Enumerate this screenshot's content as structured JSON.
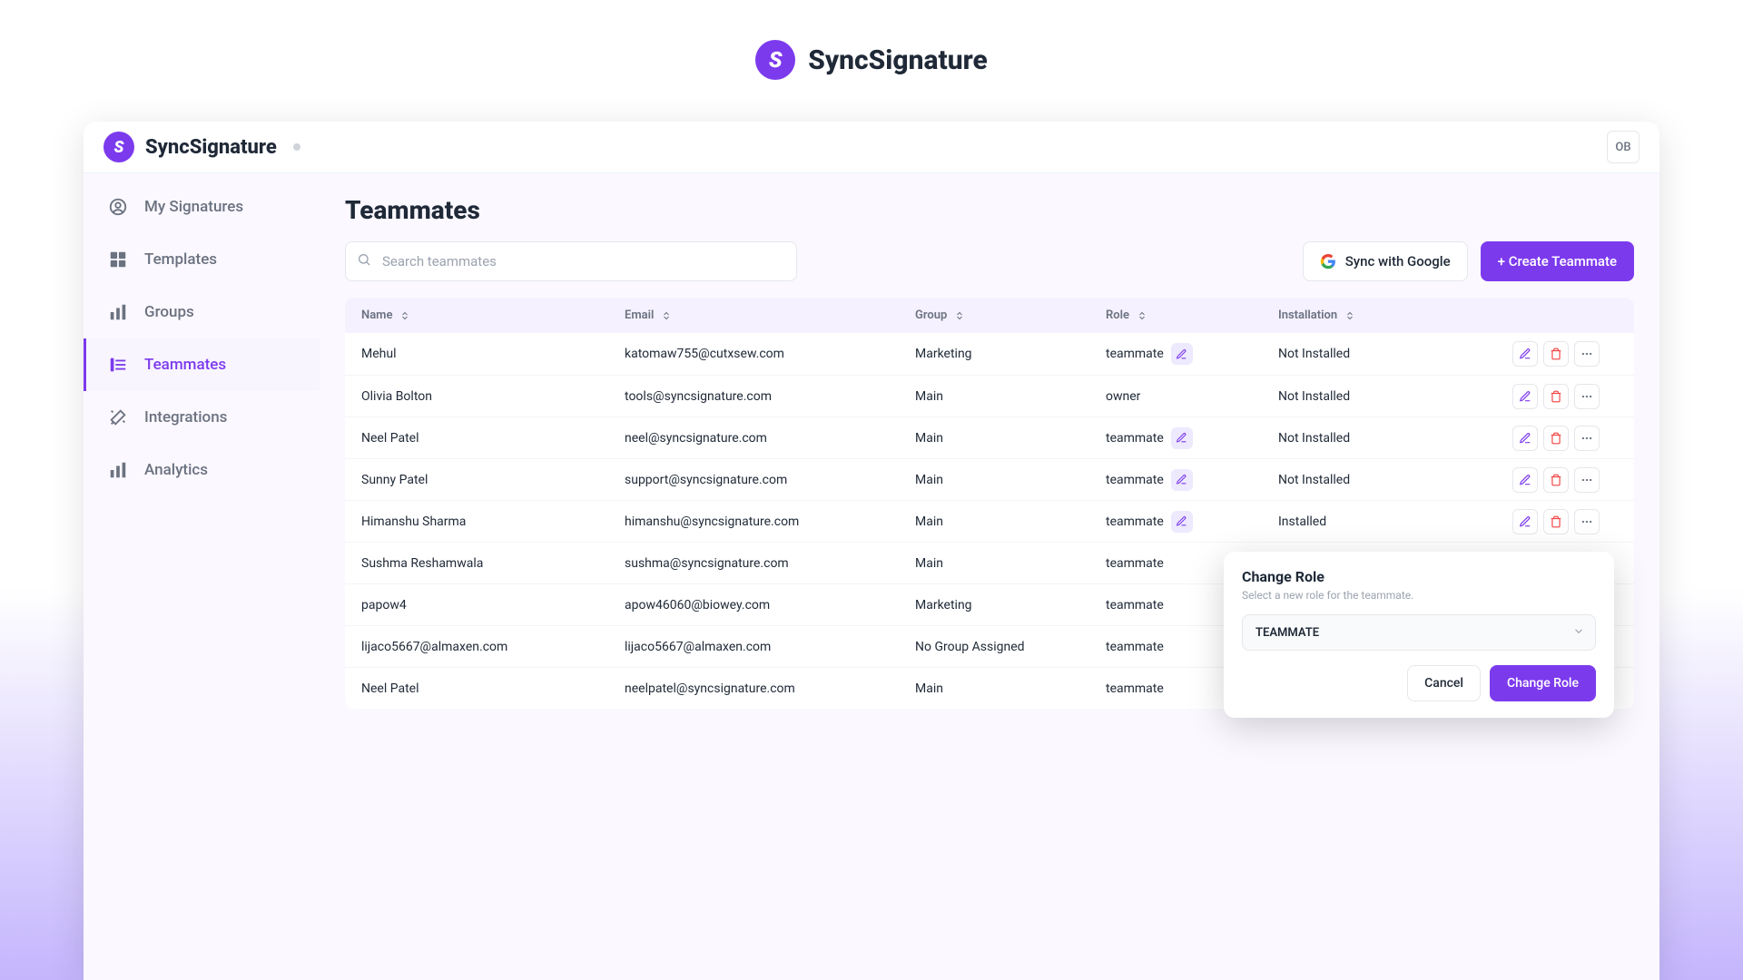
{
  "outer_brand": "SyncSignature",
  "titlebar": {
    "brand": "SyncSignature",
    "avatar": "OB"
  },
  "sidebar": {
    "items": [
      {
        "label": "My Signatures"
      },
      {
        "label": "Templates"
      },
      {
        "label": "Groups"
      },
      {
        "label": "Teammates"
      },
      {
        "label": "Integrations"
      },
      {
        "label": "Analytics"
      }
    ]
  },
  "page": {
    "title": "Teammates"
  },
  "search": {
    "placeholder": "Search teammates"
  },
  "buttons": {
    "sync": "Sync with Google",
    "create": "+ Create Teammate"
  },
  "columns": {
    "name": "Name",
    "email": "Email",
    "group": "Group",
    "role": "Role",
    "install": "Installation"
  },
  "rows": [
    {
      "name": "Mehul",
      "email": "katomaw755@cutxsew.com",
      "group": "Marketing",
      "role": "teammate",
      "install": "Not Installed",
      "role_editable": true,
      "owner": false
    },
    {
      "name": "Olivia Bolton",
      "email": "tools@syncsignature.com",
      "group": "Main",
      "role": "owner",
      "install": "Not Installed",
      "role_editable": false,
      "owner": true
    },
    {
      "name": "Neel Patel",
      "email": "neel@syncsignature.com",
      "group": "Main",
      "role": "teammate",
      "install": "Not Installed",
      "role_editable": true,
      "owner": false
    },
    {
      "name": "Sunny Patel",
      "email": "support@syncsignature.com",
      "group": "Main",
      "role": "teammate",
      "install": "Not Installed",
      "role_editable": true,
      "owner": false
    },
    {
      "name": "Himanshu Sharma",
      "email": "himanshu@syncsignature.com",
      "group": "Main",
      "role": "teammate",
      "install": "Installed",
      "role_editable": true,
      "owner": false
    },
    {
      "name": "Sushma Reshamwala",
      "email": "sushma@syncsignature.com",
      "group": "Main",
      "role": "teammate",
      "install": "",
      "role_editable": false,
      "owner": false
    },
    {
      "name": "papow4",
      "email": "apow46060@biowey.com",
      "group": "Marketing",
      "role": "teammate",
      "install": "",
      "role_editable": false,
      "owner": false
    },
    {
      "name": "lijaco5667@almaxen.com",
      "email": "lijaco5667@almaxen.com",
      "group": "No Group Assigned",
      "role": "teammate",
      "install": "",
      "role_editable": false,
      "owner": false
    },
    {
      "name": "Neel Patel",
      "email": "neelpatel@syncsignature.com",
      "group": "Main",
      "role": "teammate",
      "install": "",
      "role_editable": false,
      "owner": false
    }
  ],
  "popover": {
    "title": "Change Role",
    "subtitle": "Select a new role for the teammate.",
    "selected": "TEAMMATE",
    "cancel": "Cancel",
    "confirm": "Change Role"
  }
}
